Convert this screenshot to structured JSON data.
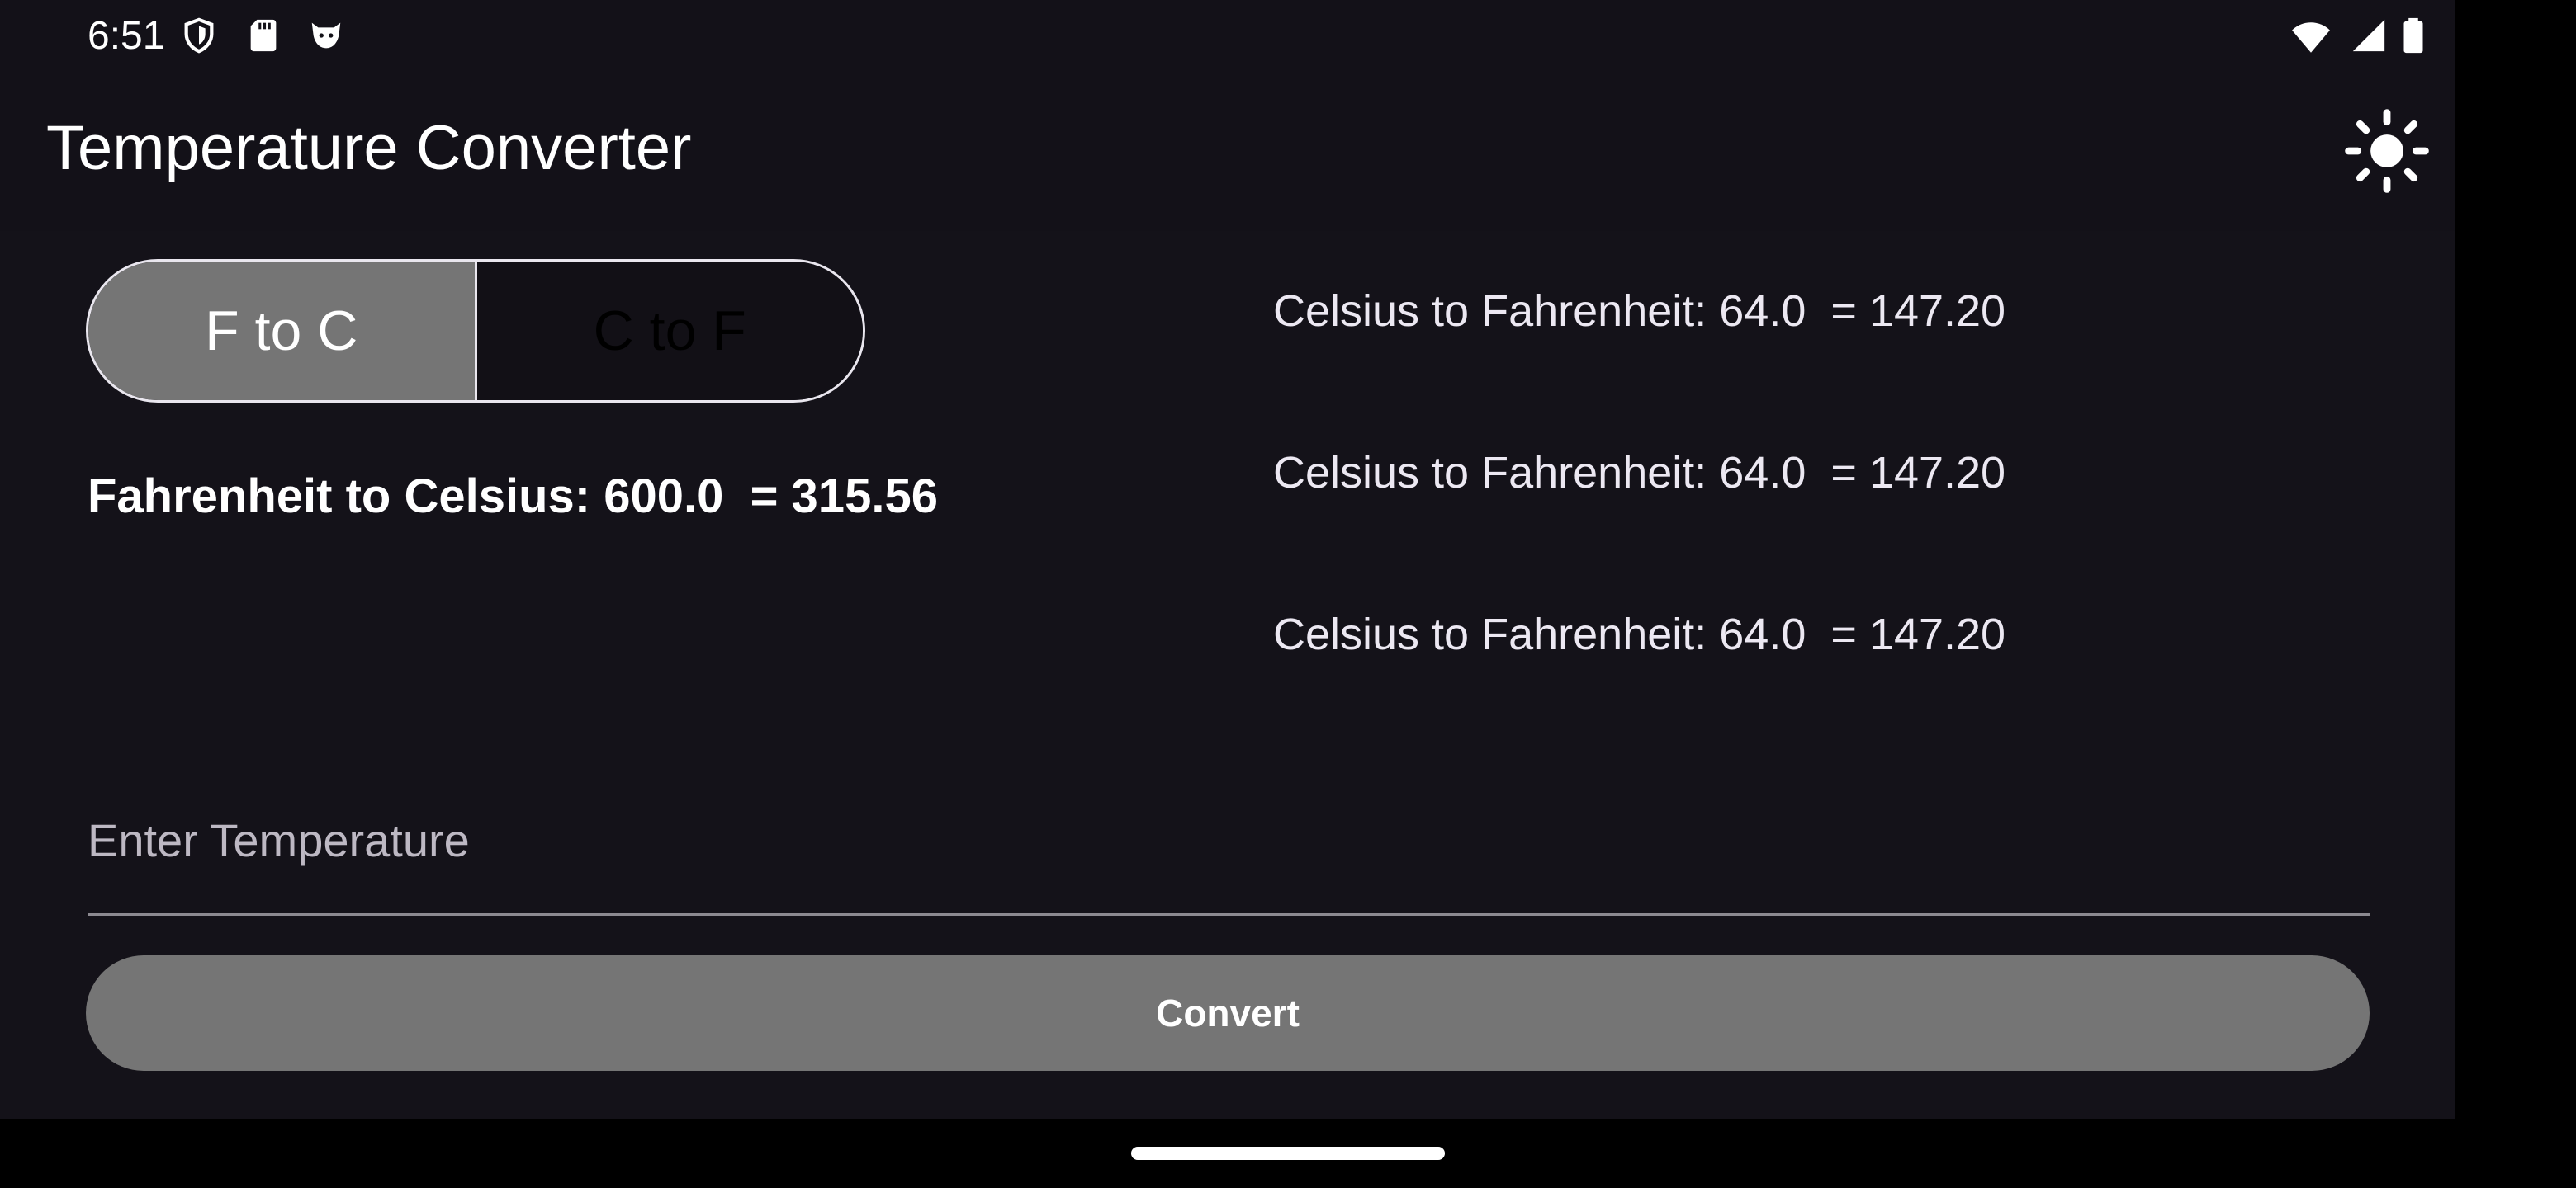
{
  "status_bar": {
    "time": "6:51",
    "left_icons": [
      "shield-icon",
      "sd-card-icon",
      "cat-icon"
    ],
    "right_icons": [
      "wifi-icon",
      "cellular-signal-icon",
      "battery-icon"
    ]
  },
  "app_bar": {
    "title": "Temperature Converter",
    "theme_icon": "sun-icon"
  },
  "mode_toggle": {
    "options": [
      {
        "label": "F to C",
        "selected": true
      },
      {
        "label": "C to F",
        "selected": false
      }
    ]
  },
  "result": {
    "text": "Fahrenheit to Celsius: 600.0  = 315.56"
  },
  "history": [
    {
      "text": "Celsius to Fahrenheit: 64.0  = 147.20"
    },
    {
      "text": "Celsius to Fahrenheit: 64.0  = 147.20"
    },
    {
      "text": "Celsius to Fahrenheit: 64.0  = 147.20"
    }
  ],
  "input": {
    "value": "",
    "placeholder": "Enter Temperature"
  },
  "convert_button": {
    "label": "Convert"
  },
  "colors": {
    "background": "#141219",
    "selected_segment": "#757575",
    "button": "#757575",
    "text": "#ffffff"
  }
}
